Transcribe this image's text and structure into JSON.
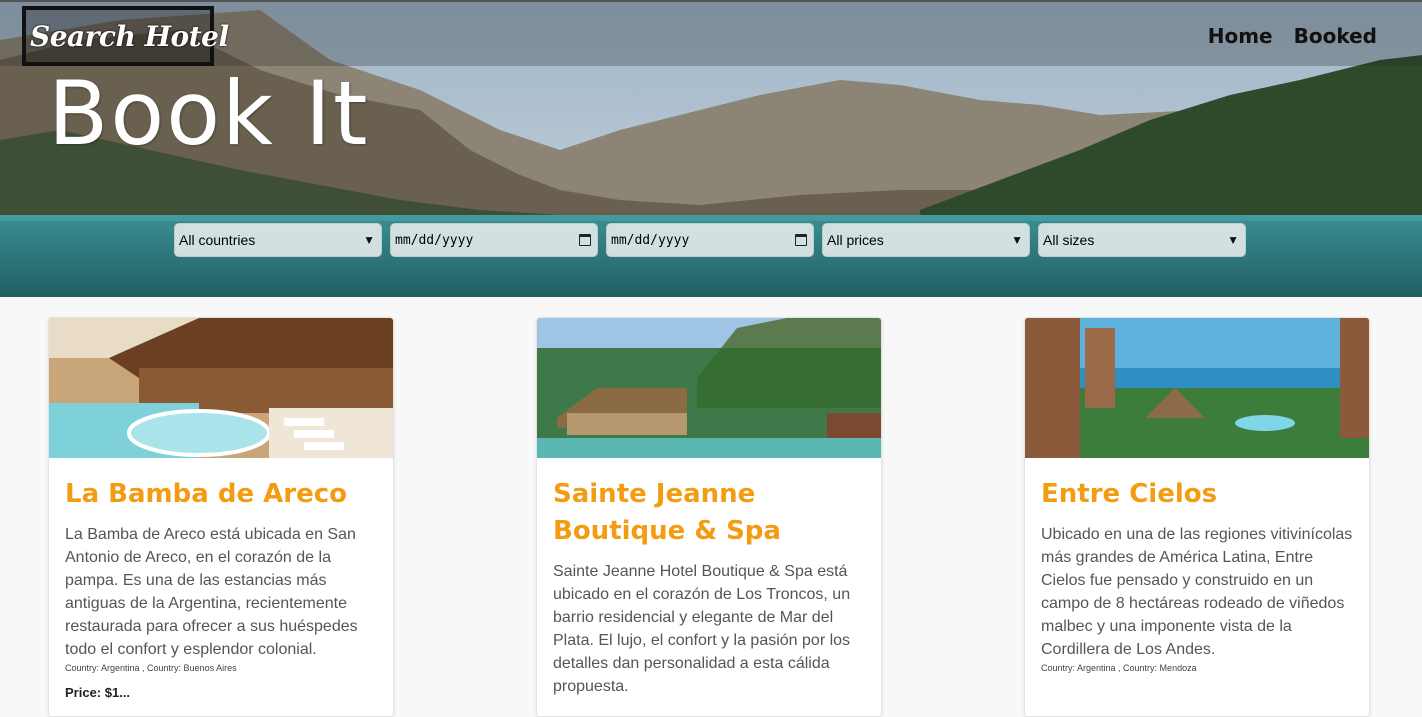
{
  "header": {
    "logo": "Search Hotel",
    "nav": [
      {
        "label": "Home"
      },
      {
        "label": "Booked"
      }
    ],
    "title": "Book It"
  },
  "filters": {
    "country": "All countries",
    "date_from": "mm/dd/yyyy",
    "date_to": "mm/dd/yyyy",
    "price": "All prices",
    "size": "All sizes"
  },
  "hotels": [
    {
      "name": "La Bamba de Areco",
      "description": "La Bamba de Areco está ubicada en San Antonio de Areco, en el corazón de la pampa. Es una de las estancias más antiguas de la Argentina, recientemente restaurada para ofrecer a sus huéspedes todo el confort y esplendor colonial.",
      "location": "Country: Argentina , Country: Buenos Aires",
      "price": "Price: $1..."
    },
    {
      "name": "Sainte Jeanne Boutique & Spa",
      "description": "Sainte Jeanne Hotel Boutique & Spa está ubicado en el corazón de Los Troncos, un barrio residencial y elegante de Mar del Plata. El lujo, el confort y la pasión por los detalles dan personalidad a esta cálida propuesta.",
      "location": "",
      "price": ""
    },
    {
      "name": "Entre Cielos",
      "description": "Ubicado en una de las regiones vitivinícolas más grandes de América Latina, Entre Cielos fue pensado y construido en un campo de 8 hectáreas rodeado de viñedos malbec y una imponente vista de la Cordillera de Los Andes.",
      "location": "Country: Argentina , Country: Mendoza",
      "price": ""
    }
  ]
}
